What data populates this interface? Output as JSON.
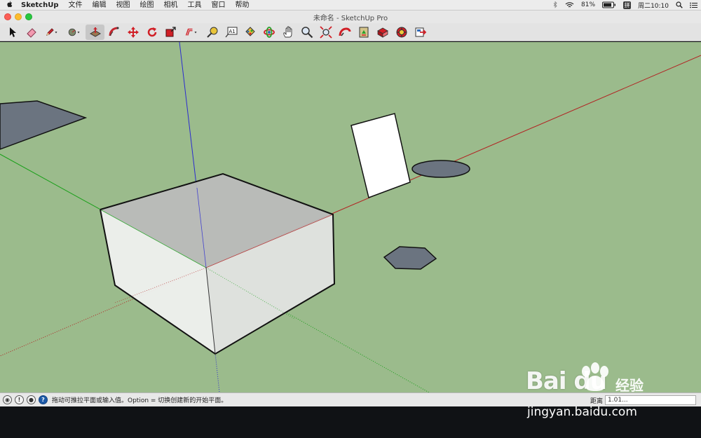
{
  "menubar": {
    "app_name": "SketchUp",
    "menus": [
      "文件",
      "编辑",
      "视图",
      "绘图",
      "相机",
      "工具",
      "窗口",
      "帮助"
    ],
    "battery": "81%",
    "input_method": "拼",
    "clock": "周二10:10"
  },
  "window": {
    "title": "未命名 - SketchUp Pro"
  },
  "toolbar": {
    "tools": [
      {
        "name": "select-tool",
        "icon": "arrow-icon"
      },
      {
        "name": "eraser-tool",
        "icon": "eraser-icon"
      },
      {
        "name": "line-tool",
        "icon": "pencil-icon",
        "dropdown": true
      },
      {
        "name": "circle-tool",
        "icon": "circle-icon",
        "dropdown": true
      },
      {
        "name": "push-pull-tool",
        "icon": "push-pull-icon",
        "active": true
      },
      {
        "name": "follow-me-tool",
        "icon": "follow-me-icon"
      },
      {
        "name": "move-tool",
        "icon": "move-icon"
      },
      {
        "name": "rotate-tool",
        "icon": "rotate-icon"
      },
      {
        "name": "scale-tool",
        "icon": "scale-icon"
      },
      {
        "name": "offset-tool",
        "icon": "offset-icon",
        "dropdown": true
      },
      {
        "name": "tape-measure-tool",
        "icon": "tape-measure-icon"
      },
      {
        "name": "text-tool",
        "icon": "text-icon"
      },
      {
        "name": "paint-bucket-tool",
        "icon": "paint-bucket-icon"
      },
      {
        "name": "orbit-tool",
        "icon": "orbit-icon"
      },
      {
        "name": "pan-tool",
        "icon": "hand-icon"
      },
      {
        "name": "zoom-tool",
        "icon": "magnifier-icon"
      },
      {
        "name": "zoom-extents-tool",
        "icon": "zoom-extents-icon"
      },
      {
        "name": "warehouse-tool",
        "icon": "warehouse-icon"
      },
      {
        "name": "share-model-tool",
        "icon": "share-model-icon"
      },
      {
        "name": "get-models-tool",
        "icon": "get-models-icon"
      },
      {
        "name": "extension-warehouse-tool",
        "icon": "extension-warehouse-icon"
      },
      {
        "name": "layout-tool",
        "icon": "layout-send-icon"
      }
    ],
    "text_tool_label": "A1"
  },
  "statusbar": {
    "message": "拖动可推拉平面或输入值。Option = 切换创建新的开始平面。",
    "vcb_label": "距离",
    "vcb_value": "1.01..."
  },
  "watermark": {
    "brand": "Bai du",
    "brand_cn": "经验",
    "url": "jingyan.baidu.com"
  },
  "colors": {
    "viewport_bg": "#9bbb8c",
    "red_axis": "#b22222",
    "green_axis": "#1aa01a",
    "blue_axis": "#2b2bd0",
    "shaded_face": "#6b7480",
    "box_top": "#bbbbbb",
    "box_front": "#f2f2f2",
    "box_right": "#e4e4e4"
  }
}
